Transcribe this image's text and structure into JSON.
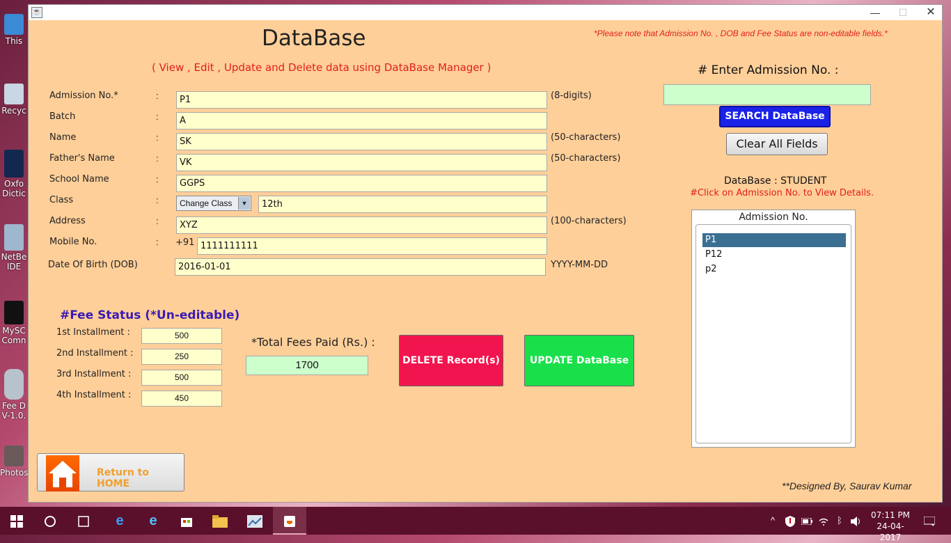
{
  "desktop": {
    "icons": [
      {
        "label": "This",
        "icon": "pc-icon"
      },
      {
        "label": "Recyc",
        "icon": "recycle-bin-icon"
      },
      {
        "label": "Oxfo Dictic",
        "icon": "dictionary-icon"
      },
      {
        "label": "NetBe IDE",
        "icon": "netbeans-icon"
      },
      {
        "label": "MySC Comn",
        "icon": "mysql-icon"
      },
      {
        "label": "Fee D V-1.0.",
        "icon": "database-icon"
      },
      {
        "label": "Photos",
        "icon": "photoshop-icon"
      }
    ]
  },
  "window": {
    "title": "DataBase",
    "subtitle": "( View , Edit , Update and Delete data using DataBase Manager )",
    "note": "*Please note that Admission No. , DOB and Fee Status are non-editable fields.*",
    "controls": {
      "minimize": "—",
      "maximize": "☐",
      "close": "✕"
    }
  },
  "form": {
    "colon": ":",
    "admission": {
      "label": "Admission No.*",
      "value": "P1",
      "hint": "(8-digits)"
    },
    "batch": {
      "label": "Batch",
      "value": "A"
    },
    "name": {
      "label": "Name",
      "value": "SK",
      "hint": "(50-characters)"
    },
    "father": {
      "label": "Father's Name",
      "value": "VK",
      "hint": "(50-characters)"
    },
    "school": {
      "label": "School Name",
      "value": "GGPS"
    },
    "class": {
      "label": "Class",
      "combo": "Change Class",
      "value": "12th"
    },
    "address": {
      "label": "Address",
      "value": "XYZ",
      "hint": "(100-characters)"
    },
    "mobile": {
      "label": "Mobile No.",
      "prefix": "+91",
      "value": "1111111111"
    },
    "dob": {
      "label": "Date Of Birth (DOB)",
      "value": "2016-01-01",
      "hint": "YYYY-MM-DD"
    }
  },
  "fees": {
    "title": "#Fee Status (*Un-editable)",
    "installments": [
      {
        "label": "1st Installment  :",
        "value": "500"
      },
      {
        "label": "2nd Installment :",
        "value": "250"
      },
      {
        "label": "3rd Installment :",
        "value": "500"
      },
      {
        "label": "4th Installment :",
        "value": "450"
      }
    ],
    "total_label": "*Total Fees Paid (Rs.) :",
    "total_value": "1700"
  },
  "actions": {
    "delete": "DELETE Record(s)",
    "update": "UPDATE   DataBase",
    "home": "Return to HOME"
  },
  "search": {
    "label": "# Enter Admission No. :",
    "value": "",
    "button": "SEARCH   DataBase",
    "clear": "Clear All Fields",
    "db_label": "DataBase : STUDENT",
    "db_hint": "#Click on Admission No. to View Details.",
    "list_header": "Admission No.",
    "items": [
      "P1",
      "P12",
      "p2"
    ],
    "selected": "P1"
  },
  "footer": "**Designed By, Saurav Kumar",
  "taskbar": {
    "time": "07:11 PM",
    "date": "24-04-2017",
    "apps": [
      "windows-start-icon",
      "cortana-icon",
      "task-view-icon",
      "edge-icon",
      "internet-explorer-icon",
      "store-icon",
      "file-explorer-icon",
      "image-app-icon",
      "java-app-icon"
    ]
  },
  "colors": {
    "window_bg": "#ffcf99",
    "field_bg": "#ffffcc",
    "accent_red": "#e0201b",
    "delete": "#f2144e",
    "update": "#19e04a",
    "search": "#1b22e8",
    "list_selected": "#3b6f92"
  }
}
